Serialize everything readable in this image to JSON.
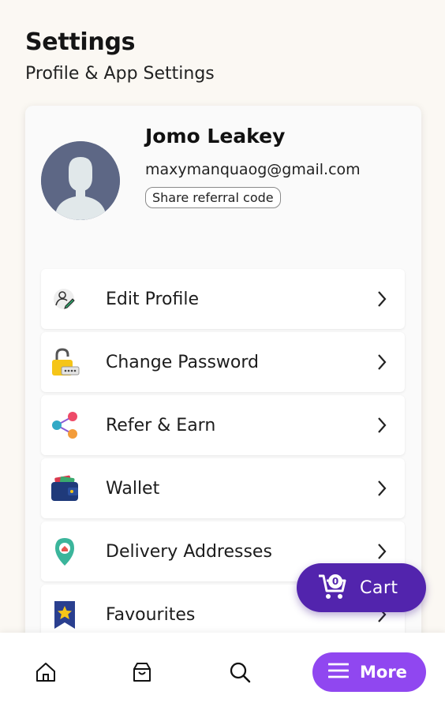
{
  "header": {
    "title": "Settings",
    "subtitle": "Profile & App Settings"
  },
  "profile": {
    "name": "Jomo Leakey",
    "email": "maxymanquaog@gmail.com",
    "referral_button": "Share referral code"
  },
  "menu": {
    "items": [
      {
        "label": "Edit Profile",
        "icon": "edit-profile-icon"
      },
      {
        "label": "Change Password",
        "icon": "padlock-icon"
      },
      {
        "label": "Refer & Earn",
        "icon": "share-icon"
      },
      {
        "label": "Wallet",
        "icon": "wallet-icon"
      },
      {
        "label": "Delivery Addresses",
        "icon": "location-pin-icon"
      },
      {
        "label": "Favourites",
        "icon": "star-bookmark-icon"
      }
    ]
  },
  "cart": {
    "label": "Cart",
    "count": "0"
  },
  "bottom_nav": {
    "more_label": "More",
    "items": [
      "home-icon",
      "orders-icon",
      "search-icon",
      "menu-icon"
    ]
  },
  "colors": {
    "background": "#fbf8f3",
    "cart_fab": "#5224ad",
    "more_button": "#9047f0"
  }
}
